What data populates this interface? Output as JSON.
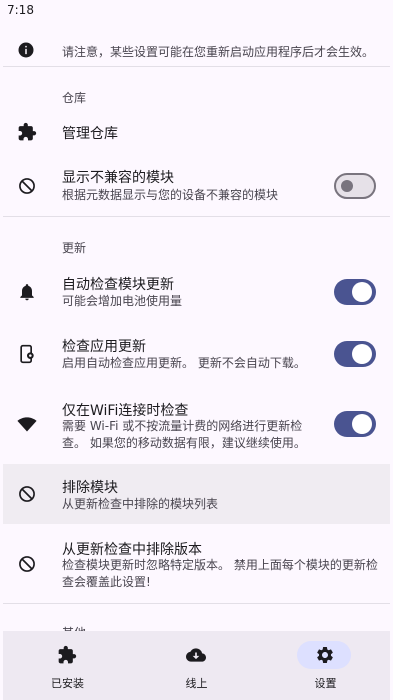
{
  "status_bar": {
    "time": "7:18"
  },
  "notice": {
    "text": "请注意，某些设置可能在您重新启动应用程序后才会生效。",
    "icon": "info-icon"
  },
  "sections": {
    "repository": {
      "header": "仓库"
    },
    "updates": {
      "header": "更新"
    },
    "partial_header": "其他"
  },
  "settings": {
    "manage_repos": {
      "title": "管理仓库",
      "icon": "puzzle-icon"
    },
    "show_incompatible": {
      "title": "显示不兼容的模块",
      "subtitle": "根据元数据显示与您的设备不兼容的模块",
      "enabled": false,
      "icon": "block-icon"
    },
    "auto_check_modules": {
      "title": "自动检查模块更新",
      "subtitle": "可能会增加电池使用量",
      "enabled": true,
      "icon": "bell-icon"
    },
    "check_app_updates": {
      "title": "检查应用更新",
      "subtitle": "启用自动检查应用更新。 更新不会自动下载。",
      "enabled": true,
      "icon": "phone-settings-icon"
    },
    "wifi_only": {
      "title": "仅在WiFi连接时检查",
      "subtitle": "需要 Wi-Fi 或不按流量计费的网络进行更新检查。 如果您的移动数据有限，建议继续使用。",
      "enabled": true,
      "icon": "wifi-icon"
    },
    "exclude_modules": {
      "title": "排除模块",
      "subtitle": "从更新检查中排除的模块列表",
      "icon": "block-icon"
    },
    "exclude_versions": {
      "title": "从更新检查中排除版本",
      "subtitle": "检查模块更新时忽略特定版本。 禁用上面每个模块的更新检查会覆盖此设置!",
      "icon": "block-icon"
    }
  },
  "bottom_nav": {
    "items": [
      {
        "label": "已安装",
        "icon": "puzzle-icon",
        "active": false
      },
      {
        "label": "线上",
        "icon": "cloud-download-icon",
        "active": false
      },
      {
        "label": "设置",
        "icon": "gear-icon",
        "active": true
      }
    ]
  },
  "colors": {
    "accent": "#4a5491",
    "background": "#fdf8ff",
    "nav_background": "#eee9f2",
    "nav_indicator": "#dde0ff"
  }
}
